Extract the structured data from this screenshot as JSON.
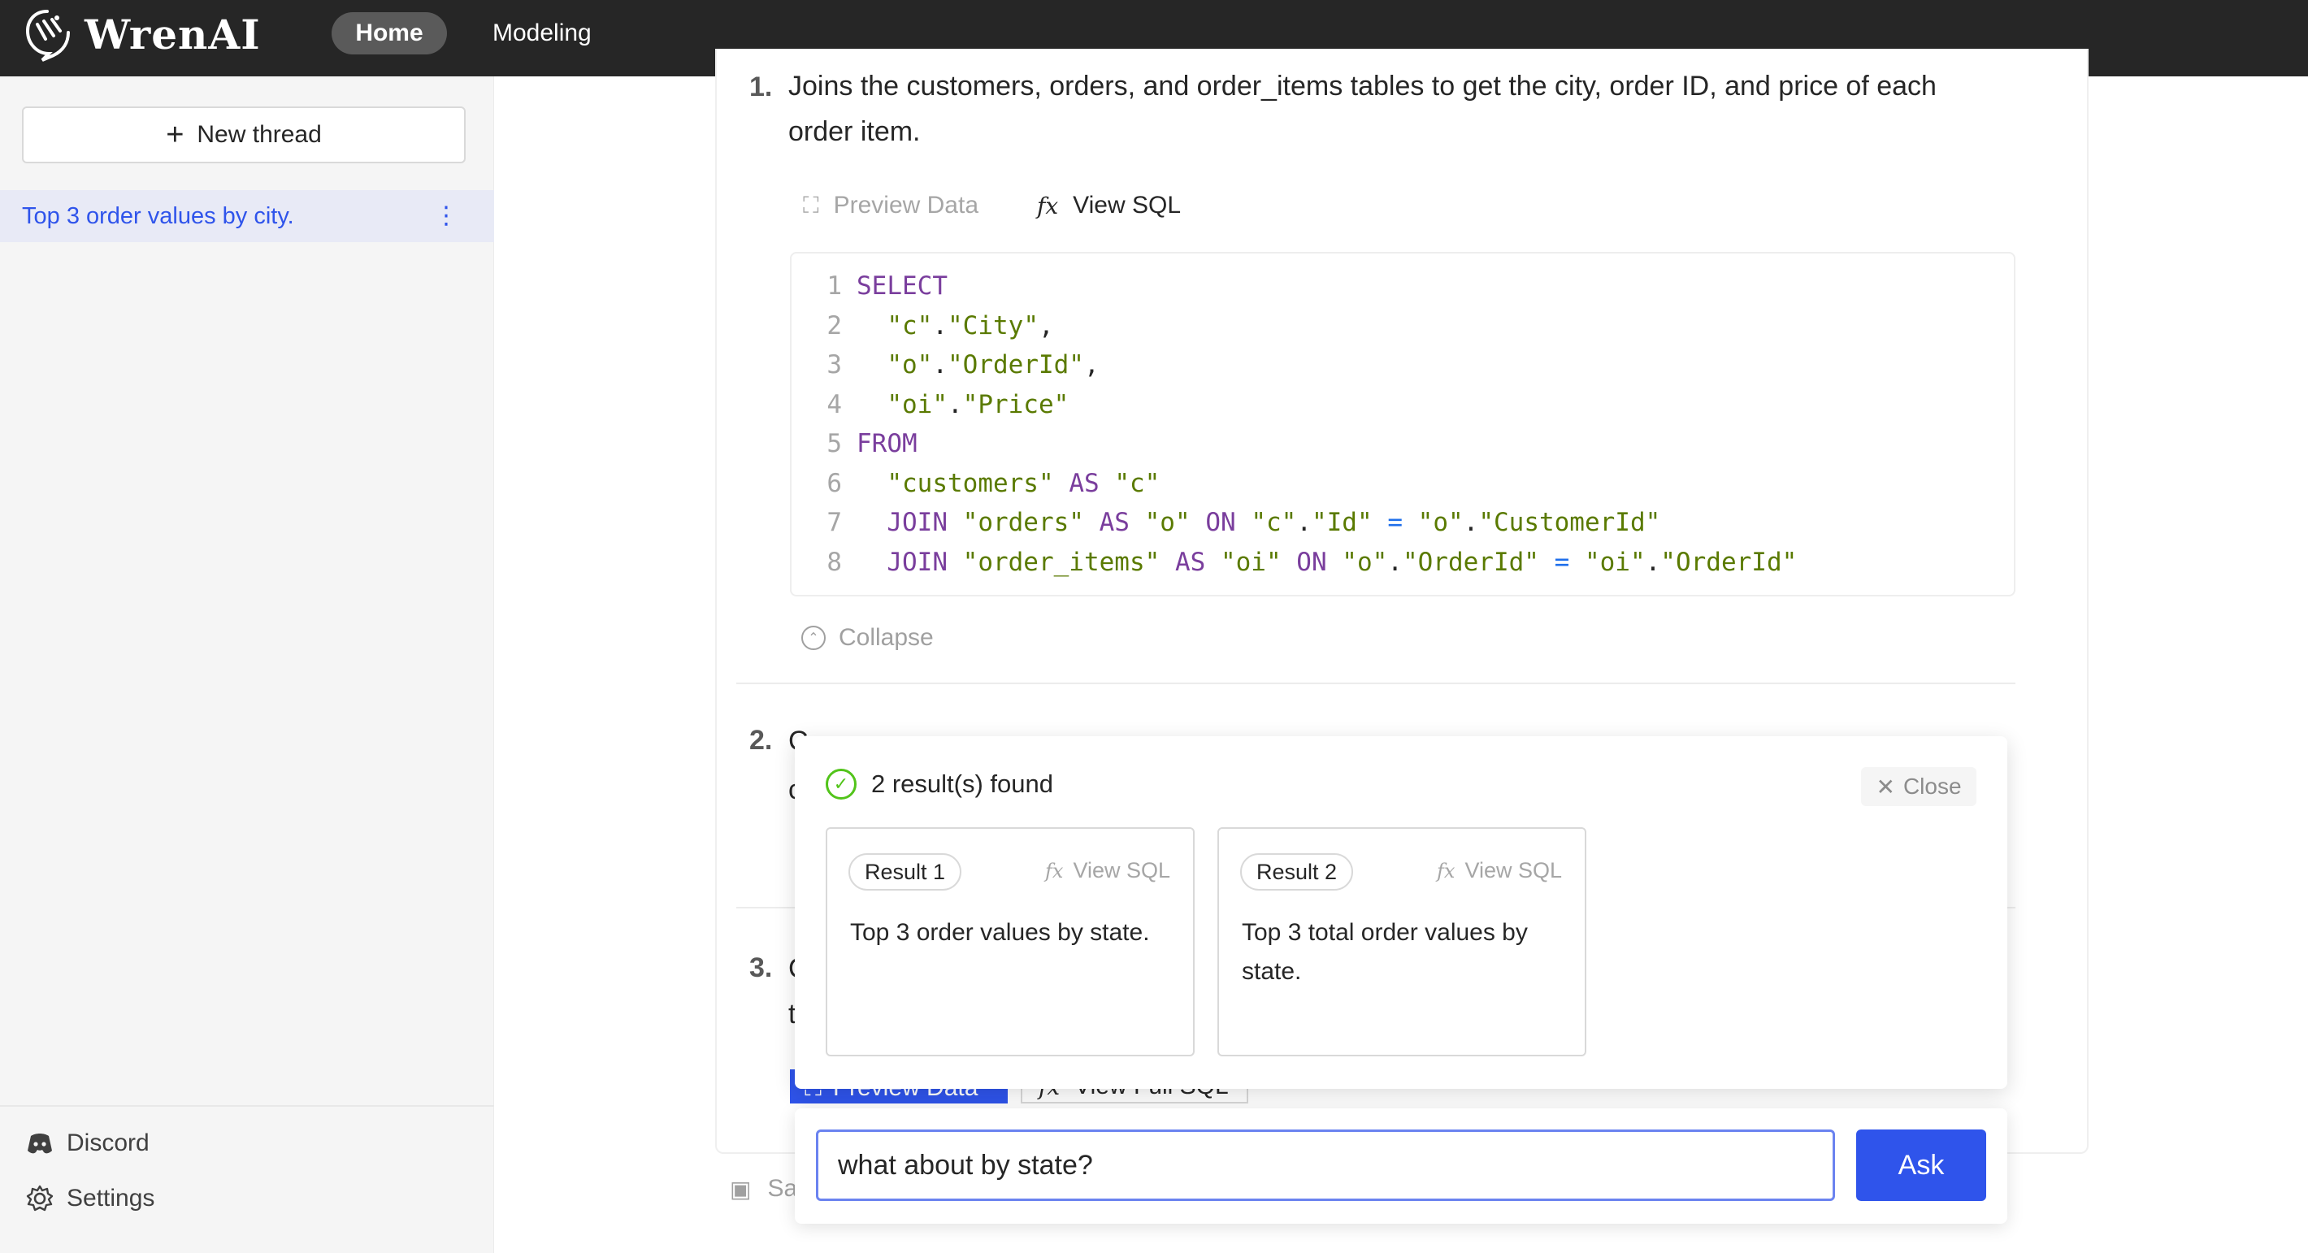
{
  "header": {
    "logo_text": "WrenAI",
    "nav": [
      {
        "label": "Home",
        "active": true
      },
      {
        "label": "Modeling",
        "active": false
      }
    ]
  },
  "sidebar": {
    "new_thread_label": "New thread",
    "threads": [
      {
        "label": "Top 3 order values by city.",
        "active": true
      }
    ],
    "bottom_links": [
      {
        "label": "Discord",
        "icon": "discord-icon"
      },
      {
        "label": "Settings",
        "icon": "gear-icon"
      }
    ]
  },
  "answer": {
    "steps": [
      {
        "number": "1.",
        "line1": "Joins the customers, orders, and order_items tables to get the city, order ID, and price of each",
        "line2": "order item."
      },
      {
        "number": "2.",
        "line1": "C",
        "line2": "c"
      },
      {
        "number": "3.",
        "line1": "C",
        "line2": "t"
      }
    ],
    "tabs": {
      "preview_data": "Preview Data",
      "view_sql": "View SQL",
      "fx": "fx"
    },
    "collapse_label": "Collapse",
    "bottom_buttons": {
      "preview_data": "Preview Data",
      "view_full_sql": "View Full SQL"
    },
    "save_label": "Sa"
  },
  "sql_lines": [
    {
      "n": "1",
      "tokens": [
        {
          "t": "SELECT",
          "c": "kw"
        }
      ]
    },
    {
      "n": "2",
      "tokens": [
        {
          "t": "  "
        },
        {
          "t": "\"c\"",
          "c": "str"
        },
        {
          "t": "."
        },
        {
          "t": "\"City\"",
          "c": "str"
        },
        {
          "t": ","
        }
      ]
    },
    {
      "n": "3",
      "tokens": [
        {
          "t": "  "
        },
        {
          "t": "\"o\"",
          "c": "str"
        },
        {
          "t": "."
        },
        {
          "t": "\"OrderId\"",
          "c": "str"
        },
        {
          "t": ","
        }
      ]
    },
    {
      "n": "4",
      "tokens": [
        {
          "t": "  "
        },
        {
          "t": "\"oi\"",
          "c": "str"
        },
        {
          "t": "."
        },
        {
          "t": "\"Price\"",
          "c": "str"
        }
      ]
    },
    {
      "n": "5",
      "tokens": [
        {
          "t": "FROM",
          "c": "kw"
        }
      ]
    },
    {
      "n": "6",
      "tokens": [
        {
          "t": "  "
        },
        {
          "t": "\"customers\"",
          "c": "str"
        },
        {
          "t": " "
        },
        {
          "t": "AS",
          "c": "kw"
        },
        {
          "t": " "
        },
        {
          "t": "\"c\"",
          "c": "str"
        }
      ]
    },
    {
      "n": "7",
      "tokens": [
        {
          "t": "  "
        },
        {
          "t": "JOIN",
          "c": "kw"
        },
        {
          "t": " "
        },
        {
          "t": "\"orders\"",
          "c": "str"
        },
        {
          "t": " "
        },
        {
          "t": "AS",
          "c": "kw"
        },
        {
          "t": " "
        },
        {
          "t": "\"o\"",
          "c": "str"
        },
        {
          "t": " "
        },
        {
          "t": "ON",
          "c": "kw"
        },
        {
          "t": " "
        },
        {
          "t": "\"c\"",
          "c": "str"
        },
        {
          "t": "."
        },
        {
          "t": "\"Id\"",
          "c": "str"
        },
        {
          "t": " "
        },
        {
          "t": "=",
          "c": "op"
        },
        {
          "t": " "
        },
        {
          "t": "\"o\"",
          "c": "str"
        },
        {
          "t": "."
        },
        {
          "t": "\"CustomerId\"",
          "c": "str"
        }
      ]
    },
    {
      "n": "8",
      "tokens": [
        {
          "t": "  "
        },
        {
          "t": "JOIN",
          "c": "kw"
        },
        {
          "t": " "
        },
        {
          "t": "\"order_items\"",
          "c": "str"
        },
        {
          "t": " "
        },
        {
          "t": "AS",
          "c": "kw"
        },
        {
          "t": " "
        },
        {
          "t": "\"oi\"",
          "c": "str"
        },
        {
          "t": " "
        },
        {
          "t": "ON",
          "c": "kw"
        },
        {
          "t": " "
        },
        {
          "t": "\"o\"",
          "c": "str"
        },
        {
          "t": "."
        },
        {
          "t": "\"OrderId\"",
          "c": "str"
        },
        {
          "t": " "
        },
        {
          "t": "=",
          "c": "op"
        },
        {
          "t": " "
        },
        {
          "t": "\"oi\"",
          "c": "str"
        },
        {
          "t": "."
        },
        {
          "t": "\"OrderId\"",
          "c": "str"
        }
      ]
    }
  ],
  "popup": {
    "title": "2 result(s) found",
    "close_label": "Close",
    "results": [
      {
        "tag": "Result 1",
        "view_sql": "View SQL",
        "text": "Top 3 order values by state."
      },
      {
        "tag": "Result 2",
        "view_sql": "View SQL",
        "text": "Top 3 total order values by state."
      }
    ]
  },
  "ask": {
    "input_value": "what about by state?",
    "button_label": "Ask"
  },
  "colors": {
    "accent": "#2f54eb",
    "header_bg": "#262626",
    "success": "#52c41a"
  }
}
